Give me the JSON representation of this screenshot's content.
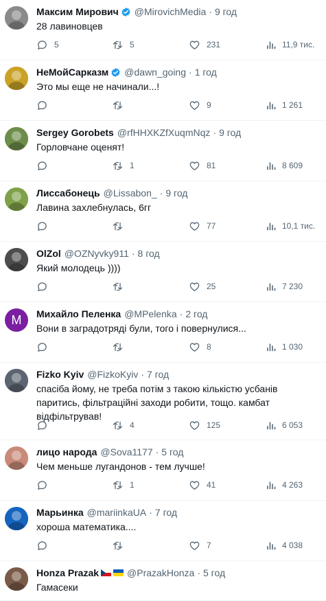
{
  "tweets": [
    {
      "name": "Максим Мирович",
      "verified": true,
      "handle": "@MirovichMedia",
      "sep": "·",
      "time": "9 год",
      "text": "28 лавиновцев",
      "replies": "5",
      "retweets": "5",
      "likes": "231",
      "views": "11,9 тис.",
      "avatar_color": "#8a8a8a"
    },
    {
      "name": "НеМойСарказм",
      "verified": true,
      "handle": "@dawn_going",
      "sep": "·",
      "time": "1 год",
      "text": "Это мы еще не начинали...!",
      "replies": "",
      "retweets": "",
      "likes": "9",
      "views": "1 261",
      "avatar_color": "#c9a227"
    },
    {
      "name": "Sergey Gorobets",
      "verified": false,
      "handle": "@rfHHXKZfXuqmNqz",
      "sep": "·",
      "time": "9 год",
      "text": "Горловчане оценят!",
      "replies": "",
      "retweets": "1",
      "likes": "81",
      "views": "8 609",
      "avatar_color": "#6d8d4a"
    },
    {
      "name": "Лиссабонець",
      "verified": false,
      "handle": "@Lissabon_",
      "sep": "·",
      "time": "9 год",
      "text": "Лавина захлебнулась, 6гг",
      "replies": "",
      "retweets": "",
      "likes": "77",
      "views": "10,1 тис.",
      "avatar_color": "#7fa14a"
    },
    {
      "name": "OlZol",
      "verified": false,
      "handle": "@OZNyvky911",
      "sep": "·",
      "time": "8 год",
      "text": "Який молодець ))))",
      "replies": "",
      "retweets": "",
      "likes": "25",
      "views": "7 230",
      "avatar_color": "#4d4d4d"
    },
    {
      "name": "Михайло Пеленка",
      "verified": false,
      "handle": "@MPelenka",
      "sep": "·",
      "time": "2 год",
      "text": "Вони в заградотряді були, того і повернулися...",
      "replies": "",
      "retweets": "",
      "likes": "8",
      "views": "1 030",
      "avatar_color": "#7b1fa2",
      "avatar_letter": "M"
    },
    {
      "name": "Fizko Kyiv",
      "verified": false,
      "handle": "@FizkoKyiv",
      "sep": "·",
      "time": "7 год",
      "text": "спасіба йому, не треба потім з такою кількістю усбанів паритись, фільтраційні заходи робити, тощо. камбат відфільтрував!",
      "replies": "",
      "retweets": "4",
      "likes": "125",
      "views": "6 053",
      "avatar_color": "#5b6470"
    },
    {
      "name": "лицо народа",
      "verified": false,
      "handle": "@Sova1177",
      "sep": "·",
      "time": "5 год",
      "text": "Чем меньше лугандонов - тем лучше!",
      "replies": "",
      "retweets": "1",
      "likes": "41",
      "views": "4 263",
      "avatar_color": "#c98a7a"
    },
    {
      "name": "Марьинка",
      "verified": false,
      "handle": "@mariinkaUA",
      "sep": "·",
      "time": "7 год",
      "text": "хороша математика....",
      "replies": "",
      "retweets": "",
      "likes": "7",
      "views": "4 038",
      "avatar_color": "#1565c0"
    },
    {
      "name": "Honza Prazak",
      "verified": false,
      "flags": true,
      "handle": "@PrazakHonza",
      "sep": "·",
      "time": "5 год",
      "text": "Гамасеки",
      "replies": "",
      "retweets": "",
      "likes": "",
      "views": "",
      "avatar_color": "#7a5a48"
    }
  ],
  "colors": {
    "accent": "#1d9bf0",
    "muted": "#536471",
    "text": "#0f1419",
    "divider": "#eff3f4"
  },
  "icons": {
    "reply": "reply-icon",
    "retweet": "retweet-icon",
    "like": "heart-icon",
    "views": "views-icon",
    "verified": "verified-badge-icon"
  }
}
